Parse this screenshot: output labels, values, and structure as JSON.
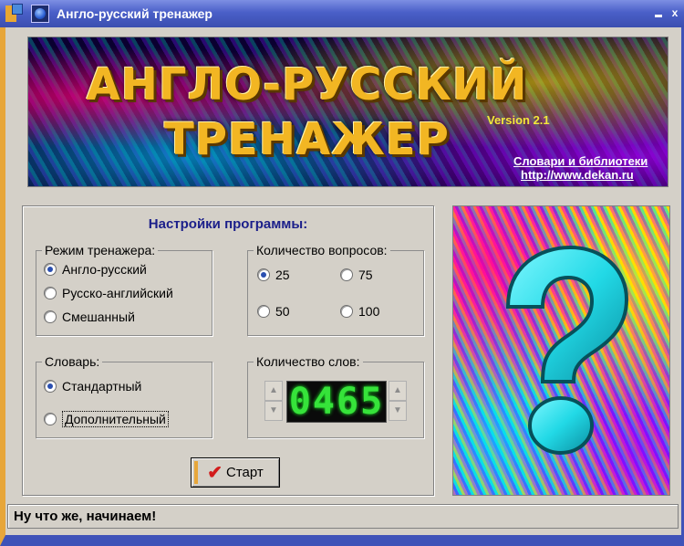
{
  "window": {
    "title": "Англо-русский тренажер",
    "minimize_glyph": "",
    "close_glyph": "x"
  },
  "banner": {
    "title_line1": "АНГЛО-РУССКИЙ",
    "title_line2": "ТРЕНАЖЕР",
    "version": "Version 2.1",
    "link_dicts": "Словари и библиотеки",
    "link_url": "http://www.dekan.ru"
  },
  "settings": {
    "title": "Настройки программы:",
    "mode": {
      "legend": "Режим тренажера:",
      "options": [
        "Англо-русский",
        "Русско-английский",
        "Смешанный"
      ],
      "selected": 0
    },
    "question_count": {
      "legend": "Количество вопросов:",
      "options": [
        "25",
        "75",
        "50",
        "100"
      ],
      "selected": "25"
    },
    "dictionary": {
      "legend": "Словарь:",
      "options": [
        "Стандартный",
        "Дополнительный"
      ],
      "selected": 0
    },
    "word_count": {
      "legend": "Количество слов:",
      "value": "0465",
      "up_glyph": "▲",
      "down_glyph": "▼"
    },
    "start_label": "Старт"
  },
  "status": {
    "text": "Ну что же, начинаем!"
  },
  "colors": {
    "accent_orange": "#e7a63a",
    "title_blue": "#3b4fb0",
    "settings_title": "#1b1f8a",
    "counter_green": "#36e33a"
  }
}
